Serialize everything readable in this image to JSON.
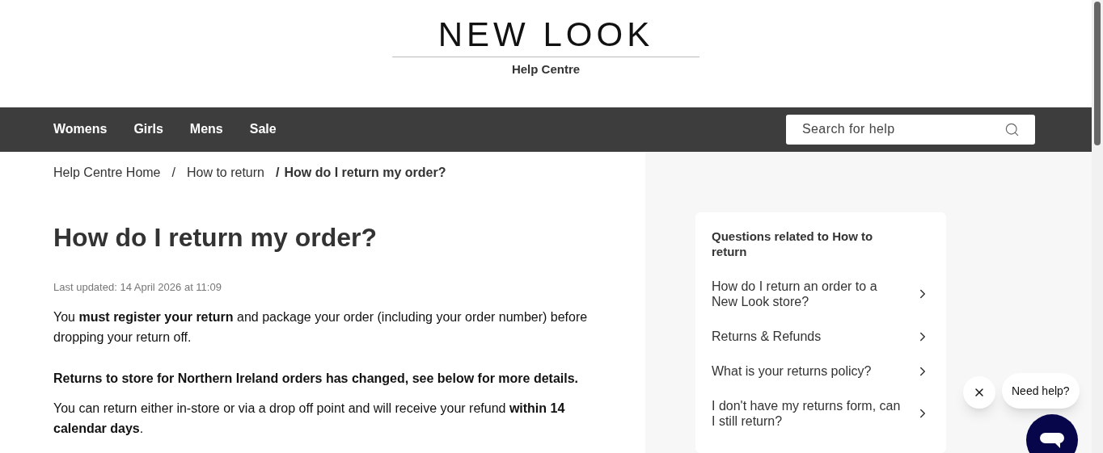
{
  "header": {
    "logo": "NEW LOOK",
    "subtitle": "Help Centre"
  },
  "nav": {
    "items": [
      {
        "label": "Womens"
      },
      {
        "label": "Girls"
      },
      {
        "label": "Mens"
      },
      {
        "label": "Sale"
      }
    ],
    "search": {
      "placeholder": "Search for help"
    }
  },
  "breadcrumb": [
    {
      "label": "Help Centre Home",
      "current": false
    },
    {
      "label": "How to return",
      "current": false
    },
    {
      "label": "How do I return my order?",
      "current": true
    }
  ],
  "breadcrumb_separator": "/",
  "article": {
    "title": "How do I return my order?",
    "updated": "Last updated: 14 April 2026 at 11:09",
    "paragraphs": [
      {
        "text": "You **must register your return** and package your order (including your order number) before dropping your return off.",
        "bold": false
      },
      {
        "text": "Returns to store for Northern Ireland orders has changed, see below for more details.",
        "bold": true
      },
      {
        "text": "You can return either in-store or via a drop off point and will receive your refund **within 14 calendar days**.",
        "bold": false
      }
    ]
  },
  "related": {
    "title": "Questions related to How to return",
    "items": [
      {
        "label": "How do I return an order to a New Look store?"
      },
      {
        "label": "Returns & Refunds"
      },
      {
        "label": "What is your returns policy?"
      },
      {
        "label": "I don't have my returns form, can I still return?"
      }
    ]
  },
  "chat": {
    "prompt": "Need help?"
  }
}
